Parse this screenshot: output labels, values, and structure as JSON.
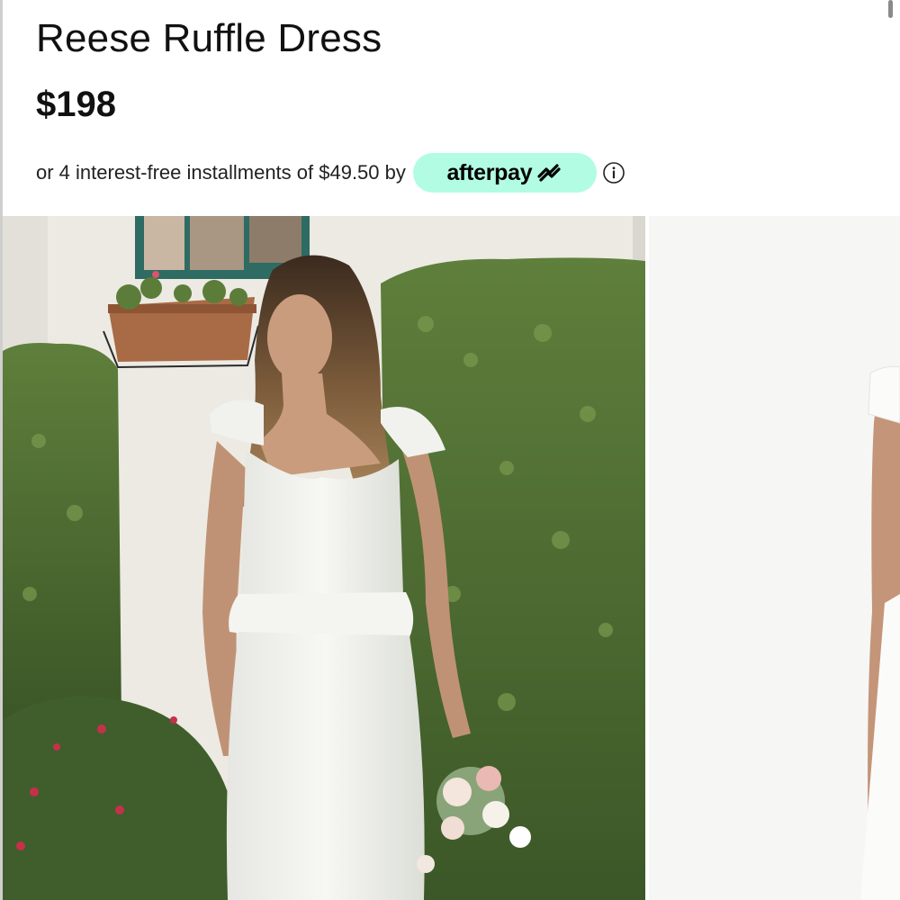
{
  "product": {
    "title": "Reese Ruffle Dress",
    "price": "$198"
  },
  "payment": {
    "installments_text": "or 4 interest-free installments of $49.50 by",
    "provider": "afterpay",
    "badge_color": "#b2fce4",
    "info_icon": "info-icon"
  },
  "gallery": {
    "images": [
      {
        "icon": "model-photo-garden"
      },
      {
        "icon": "model-photo-studio"
      }
    ]
  }
}
